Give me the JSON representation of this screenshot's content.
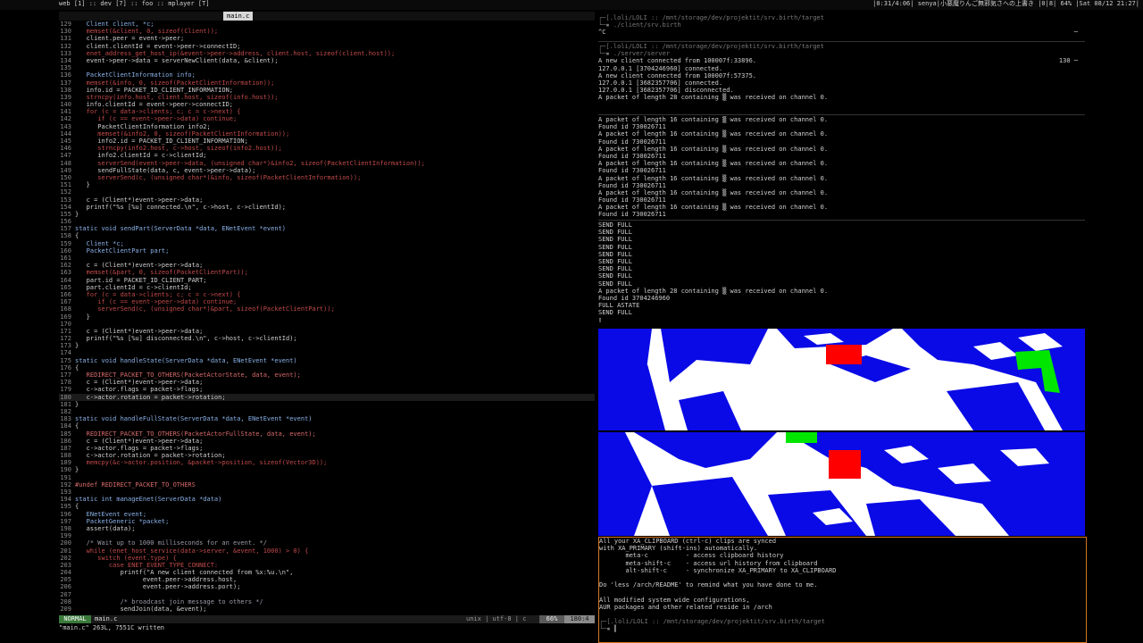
{
  "topbar": {
    "tags": "web [1] :: dev [7] :: foo :: mplayer [T]",
    "sysinfo": "|0:31/4:06| senya|小悪魔りんご無邪気さへの上書き |0|8| 64% |Sat 08/12 21:27|"
  },
  "editor": {
    "tab": "main.c",
    "lines": [
      {
        "n": "129",
        "t": "   Client client, *c;"
      },
      {
        "n": "130",
        "t": "   memset(&client, 0, sizeof(Client));"
      },
      {
        "n": "131",
        "t": "   client.peer = event->peer;"
      },
      {
        "n": "132",
        "t": "   client.clientId = event->peer->connectID;"
      },
      {
        "n": "133",
        "t": "   enet_address_get_host_ip(&event->peer->address, client.host, sizeof(client.host));"
      },
      {
        "n": "134",
        "t": "   event->peer->data = serverNewClient(data, &client);"
      },
      {
        "n": "135",
        "t": ""
      },
      {
        "n": "136",
        "t": "   PacketClientInformation info;"
      },
      {
        "n": "137",
        "t": "   memset(&info, 0, sizeof(PacketClientInformation));"
      },
      {
        "n": "138",
        "t": "   info.id = PACKET_ID_CLIENT_INFORMATION;"
      },
      {
        "n": "139",
        "t": "   strncpy(info.host, client.host, sizeof(info.host));"
      },
      {
        "n": "140",
        "t": "   info.clientId = event->peer->connectID;"
      },
      {
        "n": "141",
        "t": "   for (c = data->clients; c; c = c->next) {"
      },
      {
        "n": "142",
        "t": "      if (c == event->peer->data) continue;"
      },
      {
        "n": "143",
        "t": "      PacketClientInformation info2;"
      },
      {
        "n": "144",
        "t": "      memset(&info2, 0, sizeof(PacketClientInformation));"
      },
      {
        "n": "145",
        "t": "      info2.id = PACKET_ID_CLIENT_INFORMATION;"
      },
      {
        "n": "146",
        "t": "      strncpy(info2.host, c->host, sizeof(info2.host));"
      },
      {
        "n": "147",
        "t": "      info2.clientId = c->clientId;"
      },
      {
        "n": "148",
        "t": "      serverSend(event->peer->data, (unsigned char*)&info2, sizeof(PacketClientInformation));"
      },
      {
        "n": "149",
        "t": "      sendFullState(data, c, event->peer->data);"
      },
      {
        "n": "150",
        "t": "      serverSend(c, (unsigned char*)&info, sizeof(PacketClientInformation));"
      },
      {
        "n": "151",
        "t": "   }"
      },
      {
        "n": "152",
        "t": ""
      },
      {
        "n": "153",
        "t": "   c = (Client*)event->peer->data;"
      },
      {
        "n": "154",
        "t": "   printf(\"%s [%u] connected.\\n\", c->host, c->clientId);"
      },
      {
        "n": "155",
        "t": "}"
      },
      {
        "n": "156",
        "t": ""
      },
      {
        "n": "157",
        "t": "static void sendPart(ServerData *data, ENetEvent *event)"
      },
      {
        "n": "158",
        "t": "{"
      },
      {
        "n": "159",
        "t": "   Client *c;"
      },
      {
        "n": "160",
        "t": "   PacketClientPart part;"
      },
      {
        "n": "161",
        "t": ""
      },
      {
        "n": "162",
        "t": "   c = (Client*)event->peer->data;"
      },
      {
        "n": "163",
        "t": "   memset(&part, 0, sizeof(PacketClientPart));"
      },
      {
        "n": "164",
        "t": "   part.id = PACKET_ID_CLIENT_PART;"
      },
      {
        "n": "165",
        "t": "   part.clientId = c->clientId;"
      },
      {
        "n": "166",
        "t": "   for (c = data->clients; c; c = c->next) {"
      },
      {
        "n": "167",
        "t": "      if (c == event->peer->data) continue;"
      },
      {
        "n": "168",
        "t": "      serverSend(c, (unsigned char*)&part, sizeof(PacketClientPart));"
      },
      {
        "n": "169",
        "t": "   }"
      },
      {
        "n": "170",
        "t": ""
      },
      {
        "n": "171",
        "t": "   c = (Client*)event->peer->data;"
      },
      {
        "n": "172",
        "t": "   printf(\"%s [%u] disconnected.\\n\", c->host, c->clientId);"
      },
      {
        "n": "173",
        "t": "}"
      },
      {
        "n": "174",
        "t": ""
      },
      {
        "n": "175",
        "t": "static void handleState(ServerData *data, ENetEvent *event)"
      },
      {
        "n": "176",
        "t": "{"
      },
      {
        "n": "177",
        "t": "   REDIRECT_PACKET_TO_OTHERS(PacketActorState, data, event);"
      },
      {
        "n": "178",
        "t": "   c = (Client*)event->peer->data;"
      },
      {
        "n": "179",
        "t": "   c->actor.flags = packet->flags;"
      },
      {
        "n": "180",
        "t": "   c->actor.rotation = packet->rotation;"
      },
      {
        "n": "181",
        "t": "}"
      },
      {
        "n": "182",
        "t": ""
      },
      {
        "n": "183",
        "t": "static void handleFullState(ServerData *data, ENetEvent *event)"
      },
      {
        "n": "184",
        "t": "{"
      },
      {
        "n": "185",
        "t": "   REDIRECT_PACKET_TO_OTHERS(PacketActorFullState, data, event);"
      },
      {
        "n": "186",
        "t": "   c = (Client*)event->peer->data;"
      },
      {
        "n": "187",
        "t": "   c->actor.flags = packet->flags;"
      },
      {
        "n": "188",
        "t": "   c->actor.rotation = packet->rotation;"
      },
      {
        "n": "189",
        "t": "   memcpy(&c->actor.position, &packet->position, sizeof(Vector3D));"
      },
      {
        "n": "190",
        "t": "}"
      },
      {
        "n": "191",
        "t": ""
      },
      {
        "n": "192",
        "t": "#undef REDIRECT_PACKET_TO_OTHERS"
      },
      {
        "n": "193",
        "t": ""
      },
      {
        "n": "194",
        "t": "static int manageEnet(ServerData *data)"
      },
      {
        "n": "195",
        "t": "{"
      },
      {
        "n": "196",
        "t": "   ENetEvent event;"
      },
      {
        "n": "197",
        "t": "   PacketGeneric *packet;"
      },
      {
        "n": "198",
        "t": "   assert(data);"
      },
      {
        "n": "199",
        "t": ""
      },
      {
        "n": "200",
        "t": "   /* Wait up to 1000 milliseconds for an event. */"
      },
      {
        "n": "201",
        "t": "   while (enet_host_service(data->server, &event, 1000) > 0) {"
      },
      {
        "n": "202",
        "t": "      switch (event.type) {"
      },
      {
        "n": "203",
        "t": "         case ENET_EVENT_TYPE_CONNECT:"
      },
      {
        "n": "204",
        "t": "            printf(\"A new client connected from %x:%u.\\n\","
      },
      {
        "n": "205",
        "t": "                  event.peer->address.host,"
      },
      {
        "n": "206",
        "t": "                  event.peer->address.port);"
      },
      {
        "n": "207",
        "t": ""
      },
      {
        "n": "208",
        "t": "            /* broadcast join message to others */"
      },
      {
        "n": "209",
        "t": "            sendJoin(data, &event);"
      }
    ],
    "status": {
      "mode": "NORMAL",
      "file": "main.c",
      "format": "unix | utf-8 | c",
      "percent": "66%",
      "position": "180:4"
    },
    "cmdline": "\"main.c\" 263L, 7551C written"
  },
  "terminal": {
    "pane1": [
      "┌─[.loli/LOLI :: /mnt/storage/dev/projektit/srv.birth/target",
      "└─▪ ./client/srv.birth",
      "^C"
    ],
    "pane2_badge": "130 ─",
    "pane1_badge": "─",
    "pane2": [
      "┌─[.loli/LOLI :: /mnt/storage/dev/projektit/srv.birth/target",
      "└─▪ ./server/server",
      "A new client connected from 100007f:33896.",
      "127.0.0.1 [3704246960] connected.",
      "A new client connected from 100007f:57375.",
      "127.0.0.1 [3682357706] connected.",
      "127.0.0.1 [3682357706] disconnected.",
      "A packet of length 28 containing ▒ was received on channel 0."
    ],
    "pane3": [
      "A packet of length 16 containing ▒ was received on channel 0.",
      "Found id 730026711",
      "A packet of length 16 containing ▒ was received on channel 0.",
      "Found id 730026711",
      "A packet of length 16 containing ▒ was received on channel 0.",
      "Found id 730026711",
      "A packet of length 16 containing ▒ was received on channel 0.",
      "Found id 730026711",
      "A packet of length 16 containing ▒ was received on channel 0.",
      "Found id 730026711",
      "A packet of length 16 containing ▒ was received on channel 0.",
      "Found id 730026711",
      "A packet of length 16 containing ▒ was received on channel 0.",
      "Found id 730026711"
    ],
    "pane4": [
      "SEND FULL",
      "SEND FULL",
      "SEND FULL",
      "SEND FULL",
      "SEND FULL",
      "SEND FULL",
      "SEND FULL",
      "SEND FULL",
      "SEND FULL",
      "A packet of length 28 containing ▒ was received on channel 0.",
      "Found id 3704246960",
      "FULL ASTATE",
      "SEND FULL",
      "▯"
    ],
    "pane6": [
      "All your XA_CLIPBOARD (ctrl-c) clips are synced",
      "with XA_PRIMARY (shift-ins) automatically.",
      "       meta-c          - access clipboard history",
      "       meta-shift-c    - access url history from clipboard",
      "       alt-shift-c     - synchronize XA_PRIMARY to XA_CLIPBOARD",
      "",
      "Do 'less /arch/README' to remind what you have done to me.",
      "",
      "All modified system wide configurations,",
      "AUR packages and other related reside in /arch",
      "",
      "┌─[.loli/LOLI :: /mnt/storage/dev/projektit/srv.birth/target",
      "└─▪ ▌"
    ]
  },
  "colors": {
    "cube_blue": "#0a0ae6",
    "red_player": "#ff0000",
    "green_player": "#00e600",
    "focus_border": "#d6761e",
    "vim_mode": "#3b7a3b"
  }
}
